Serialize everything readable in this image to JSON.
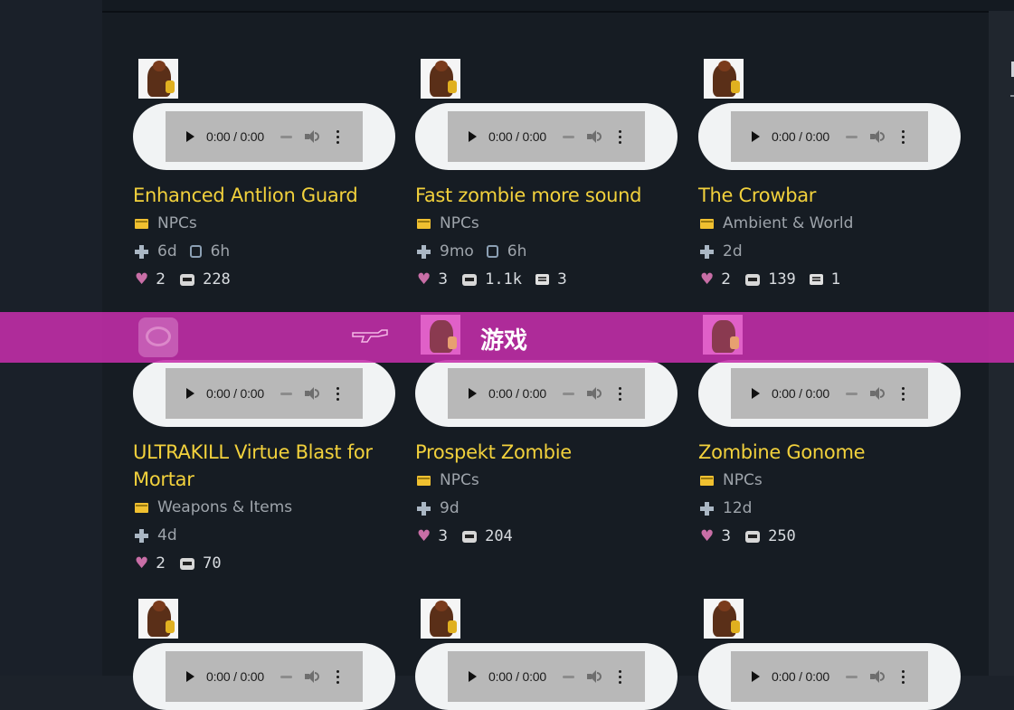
{
  "audio": {
    "time": "0:00 / 0:00"
  },
  "banner": {
    "label": "游戏"
  },
  "cards": [
    {
      "title": "Enhanced Antlion Guard",
      "category": "NPCs",
      "added": "6d",
      "updated": "6h",
      "likes": "2",
      "downloads": "228",
      "comments": ""
    },
    {
      "title": "Fast zombie more sound",
      "category": "NPCs",
      "added": "9mo",
      "updated": "6h",
      "likes": "3",
      "downloads": "1.1k",
      "comments": "3"
    },
    {
      "title": "The Crowbar",
      "category": "Ambient & World",
      "added": "2d",
      "updated": "",
      "likes": "2",
      "downloads": "139",
      "comments": "1"
    },
    {
      "title": "ULTRAKILL Virtue Blast for Mortar",
      "category": "Weapons & Items",
      "added": "4d",
      "updated": "",
      "likes": "2",
      "downloads": "70",
      "comments": ""
    },
    {
      "title": "Prospekt Zombie",
      "category": "NPCs",
      "added": "9d",
      "updated": "",
      "likes": "3",
      "downloads": "204",
      "comments": ""
    },
    {
      "title": "Zombine Gonome",
      "category": "NPCs",
      "added": "12d",
      "updated": "",
      "likes": "3",
      "downloads": "250",
      "comments": ""
    }
  ]
}
